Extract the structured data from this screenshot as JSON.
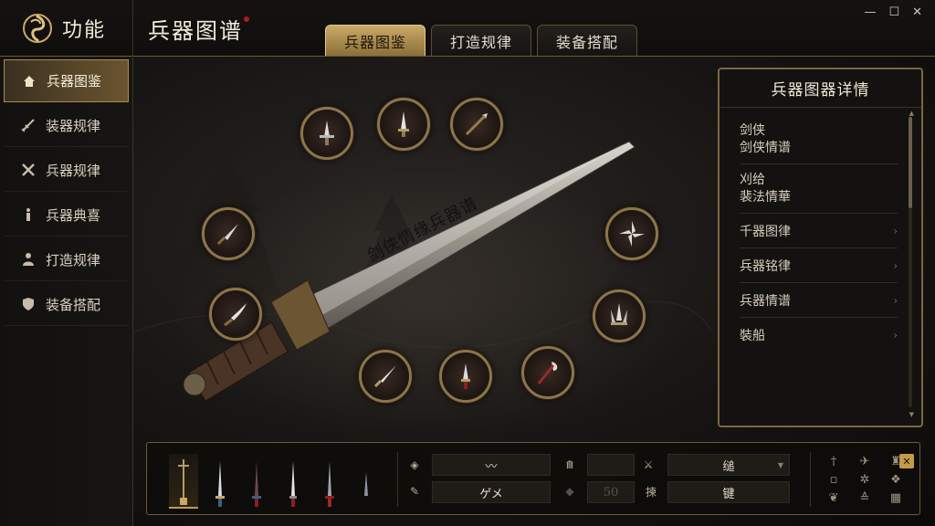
{
  "app": {
    "title": "功能",
    "page_heading": "兵器图谱"
  },
  "tabs": [
    {
      "label": "兵器图鉴",
      "active": true
    },
    {
      "label": "打造规律",
      "active": false
    },
    {
      "label": "装备搭配",
      "active": false
    }
  ],
  "window_controls": {
    "minimize": "—",
    "maximize": "☐",
    "close": "✕"
  },
  "sidebar": {
    "items": [
      {
        "label": "兵器图鉴",
        "icon": "house-icon",
        "active": true
      },
      {
        "label": "装器规律",
        "icon": "sword-icon",
        "active": false
      },
      {
        "label": "兵器规律",
        "icon": "crossed-tools-icon",
        "active": false
      },
      {
        "label": "兵器典喜",
        "icon": "figure-icon",
        "active": false
      },
      {
        "label": "打造规律",
        "icon": "person-icon",
        "active": false
      },
      {
        "label": "装备搭配",
        "icon": "shield-icon",
        "active": false
      }
    ]
  },
  "showcase": {
    "blade_inscription": "剑侠情缘兵器谱"
  },
  "detail": {
    "title": "兵器图器详情",
    "items": [
      {
        "line1": "剑侠",
        "line2": "剑侠情谱"
      },
      {
        "line1": "刈给",
        "line2": "裴法情華"
      },
      {
        "line1": "千器图律",
        "chevron": "›"
      },
      {
        "line1": "兵器铭律",
        "chevron": "›"
      },
      {
        "line1": "兵器情谱",
        "chevron": "›"
      },
      {
        "line1": "裝船",
        "chevron": "›"
      }
    ]
  },
  "bottom": {
    "field1": "〰",
    "field2": "ゲメ",
    "field3": "",
    "field4": "50",
    "field5": "缒",
    "field6": "键",
    "label_a": "缍",
    "label_b": "揀"
  },
  "colors": {
    "gold": "#c9a966",
    "border": "#7c6640",
    "seal": "#b0191c"
  }
}
